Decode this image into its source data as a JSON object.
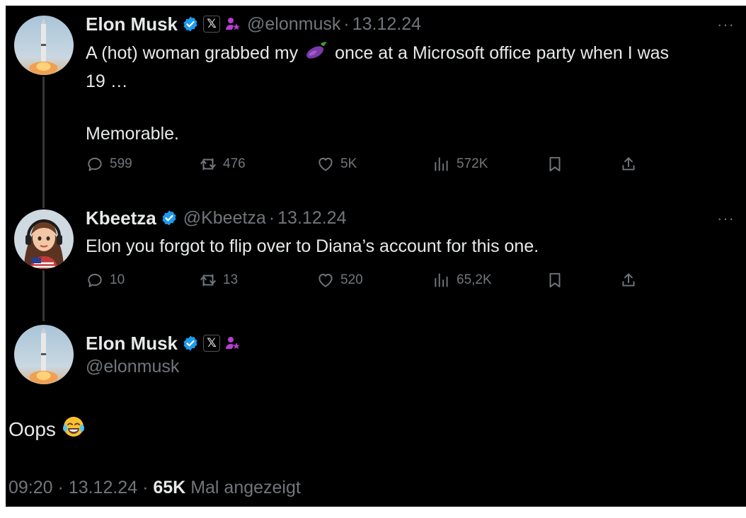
{
  "tweets": [
    {
      "name": "Elon Musk",
      "handle": "@elonmusk",
      "date": "13.12.24",
      "text_before": "A (hot) woman grabbed my",
      "text_after": "once at a Microsoft office party when I was",
      "text_line2": "19 …",
      "text_para2": "Memorable.",
      "replies": "599",
      "reposts": "476",
      "likes": "5K",
      "views": "572K"
    },
    {
      "name": "Kbeetza",
      "handle": "@Kbeetza",
      "date": "13.12.24",
      "text": "Elon you forgot to flip over to Diana’s account for this one.",
      "replies": "10",
      "reposts": "13",
      "likes": "520",
      "views": "65,2K"
    }
  ],
  "main_tweet": {
    "name": "Elon Musk",
    "handle": "@elonmusk",
    "text": "Oops",
    "time": "09:20",
    "date": "13.12.24",
    "views": "65K",
    "views_label": "Mal angezeigt"
  },
  "x_badge": "𝕏",
  "more_glyph": "···",
  "separator": "·",
  "colors": {
    "background": "#000000",
    "text": "#e7e9ea",
    "muted": "#71767b",
    "verified": "#1d9bf0",
    "affiliate": "#b63ed0"
  }
}
